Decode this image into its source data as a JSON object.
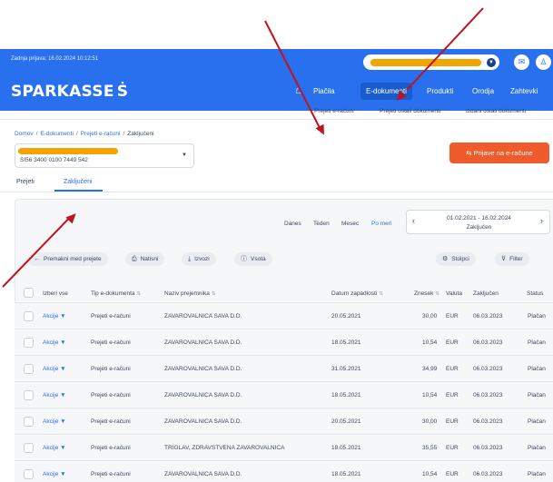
{
  "header": {
    "last_login": "Zadnja prijava: 16.02.2024 10:12:51",
    "logo_text": "SPARKASSE",
    "logo_symbol": "Ṡ",
    "mail_icon": "mail-icon",
    "user_icon": "user-icon",
    "home_icon": "home-icon",
    "nav": [
      "Plačila",
      "E-dokumenti",
      "Produkti",
      "Orodja",
      "Zahtevki"
    ],
    "active_nav": "E-dokumenti",
    "colors": {
      "brand_blue": "#2870ed",
      "orange": "#ef5b2c",
      "annotation_red": "#c1121f",
      "highlight_orange": "#f5a300"
    }
  },
  "subnav": [
    "Prejeti e-računi",
    "Prejeti ostali dokumenti",
    "Izdani ostali dokumenti"
  ],
  "breadcrumb": [
    "Domov",
    "E-dokumenti",
    "Prejeti e-računi",
    "Zaključeni"
  ],
  "account": {
    "iban": "SI56 3400 0100 7449 542"
  },
  "orange_button": {
    "label": "Prijave na e-račune",
    "icon": "swap-icon"
  },
  "tabs": [
    "Prejeti",
    "Zaključeni"
  ],
  "period_filters": [
    "Danes",
    "Teden",
    "Mesec",
    "Po meri"
  ],
  "date_range": {
    "line1": "01.02.2021 - 16.02.2024",
    "line2": "Zaključen"
  },
  "actions": {
    "move": "Premakni med prejete",
    "print": "Natisni",
    "export": "Izvozi",
    "sum": "Vsota",
    "columns": "Stolpci",
    "filter": "Filter"
  },
  "table": {
    "headers": [
      "Izberi vse",
      "Tip e-dokumenta",
      "Naziv prejemnika",
      "Datum zapadlosti",
      "Znesek",
      "Valuta",
      "Zaključen",
      "Status"
    ],
    "rows": [
      {
        "action": "Akcije",
        "type": "Prejeti e-računi",
        "recipient": "ZAVAROVALNICA SAVA D.D.",
        "due": "20.05.2021",
        "amount": "30,00",
        "currency": "EUR",
        "closed": "06.03.2023",
        "status": "Plačan"
      },
      {
        "action": "Akcije",
        "type": "Prejeti e-računi",
        "recipient": "ZAVAROVALNICA SAVA D.D.",
        "due": "18.05.2021",
        "amount": "10,54",
        "currency": "EUR",
        "closed": "06.03.2023",
        "status": "Plačan"
      },
      {
        "action": "Akcije",
        "type": "Prejeti e-računi",
        "recipient": "ZAVAROVALNICA SAVA D.D.",
        "due": "31.05.2021",
        "amount": "34,99",
        "currency": "EUR",
        "closed": "06.03.2023",
        "status": "Plačan"
      },
      {
        "action": "Akcije",
        "type": "Prejeti e-računi",
        "recipient": "ZAVAROVALNICA SAVA D.D.",
        "due": "18.05.2021",
        "amount": "10,54",
        "currency": "EUR",
        "closed": "06.03.2023",
        "status": "Plačan"
      },
      {
        "action": "Akcije",
        "type": "Prejeti e-računi",
        "recipient": "ZAVAROVALNICA SAVA D.D.",
        "due": "20.05.2021",
        "amount": "30,00",
        "currency": "EUR",
        "closed": "06.03.2023",
        "status": "Plačan"
      },
      {
        "action": "Akcije",
        "type": "Prejeti e-računi",
        "recipient": "TRIGLAV, ZDRAVSTVENA ZAVAROVALNICA",
        "due": "18.05.2021",
        "amount": "35,55",
        "currency": "EUR",
        "closed": "06.03.2023",
        "status": "Plačan"
      },
      {
        "action": "Akcije",
        "type": "Prejeti e-računi",
        "recipient": "ZAVAROVALNICA SAVA D.D.",
        "due": "18.05.2021",
        "amount": "10,54",
        "currency": "EUR",
        "closed": "06.03.2023",
        "status": "Plačan"
      }
    ]
  }
}
